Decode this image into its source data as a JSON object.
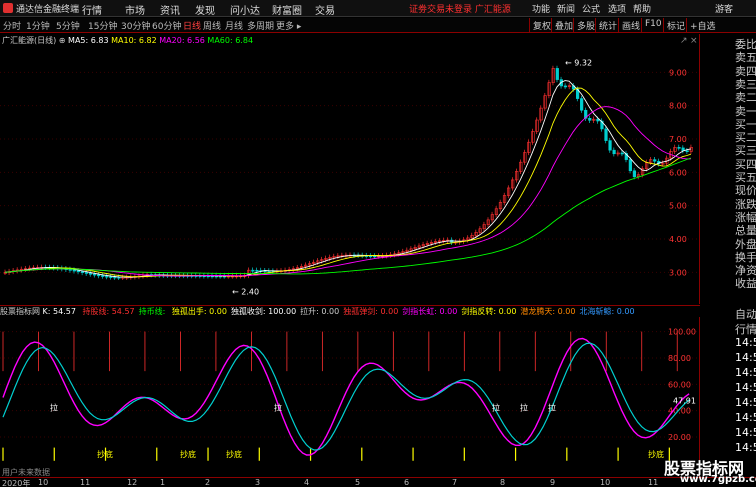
{
  "app": {
    "title": "通达信金融终端"
  },
  "menu": [
    "行情",
    "市场",
    "资讯",
    "发现",
    "问小达",
    "财富圈",
    "交易"
  ],
  "login_status": "证劵交易未登录 广汇能源",
  "right_menu": [
    "功能",
    "新闻",
    "公式",
    "选项",
    "帮助",
    "游客"
  ],
  "periods": [
    "分时",
    "1分钟",
    "5分钟",
    "15分钟",
    "30分钟",
    "60分钟",
    "日线",
    "周线",
    "月线",
    "多周期",
    "更多 ▸"
  ],
  "active_period": "日线",
  "tools": [
    "复权",
    "叠加",
    "多股",
    "统计",
    "画线",
    "F10",
    "标记",
    "+自选"
  ],
  "stock": {
    "name": "广汇能源(日线)"
  },
  "ma": {
    "ma5": "MA5: 6.83",
    "ma10": "MA10: 6.82",
    "ma20": "MA20: 6.56",
    "ma60": "MA60: 6.84"
  },
  "price_axis": [
    "9.00",
    "8.00",
    "7.00",
    "6.00",
    "5.00",
    "4.00",
    "3.00"
  ],
  "annotations": {
    "high": "9.32",
    "low": "2.40"
  },
  "indicator": {
    "name": "股票指标网",
    "k": "K: 54.57",
    "lines": [
      {
        "label": "持股线:",
        "value": "54.57"
      },
      {
        "label": "持币线:",
        "value": ""
      },
      {
        "label": "独孤出手:",
        "value": "0.00"
      },
      {
        "label": "独孤收剑:",
        "value": "100.00"
      },
      {
        "label": "拉升:",
        "value": "0.00"
      },
      {
        "label": "独孤弹剑:",
        "value": "0.00"
      },
      {
        "label": "剑指长虹:",
        "value": "0.00"
      },
      {
        "label": "剑指反转:",
        "value": "0.00"
      },
      {
        "label": "潜龙腾天:",
        "value": "0.00"
      },
      {
        "label": "北海斩鲸:",
        "value": "0.00"
      }
    ],
    "axis": [
      "100.00",
      "80.00",
      "60.00",
      "40.00",
      "20.00"
    ],
    "current": "47.91",
    "marks": {
      "bottom": "抄底",
      "pull": "拉",
      "escape": "逃",
      "top_left": "用户未来数据"
    }
  },
  "dates": [
    "2020年",
    "10",
    "11",
    "12",
    "1",
    "2",
    "3",
    "4",
    "5",
    "6",
    "7",
    "8",
    "9",
    "10",
    "11"
  ],
  "sidebar_top": [
    "委比",
    "卖五",
    "卖四",
    "卖三",
    "卖二",
    "卖一",
    "买一",
    "买二",
    "买三",
    "买四",
    "买五",
    "现价",
    "涨跌",
    "涨幅",
    "总量",
    "外盘",
    "换手",
    "净资",
    "收益"
  ],
  "sidebar_bottom": [
    "自动",
    "行情",
    "14:5",
    "14:5",
    "14:5",
    "14:5",
    "14:5",
    "14:5",
    "14:5",
    "14:5"
  ],
  "watermark": {
    "text": "股票指标网",
    "url": "www.7gpzb.com"
  },
  "colors": {
    "up": "#ff3030",
    "down": "#00d0d0",
    "ma5": "#ffffff",
    "ma10": "#ffff00",
    "ma20": "#ff00ff",
    "ma60": "#00ff00"
  }
}
